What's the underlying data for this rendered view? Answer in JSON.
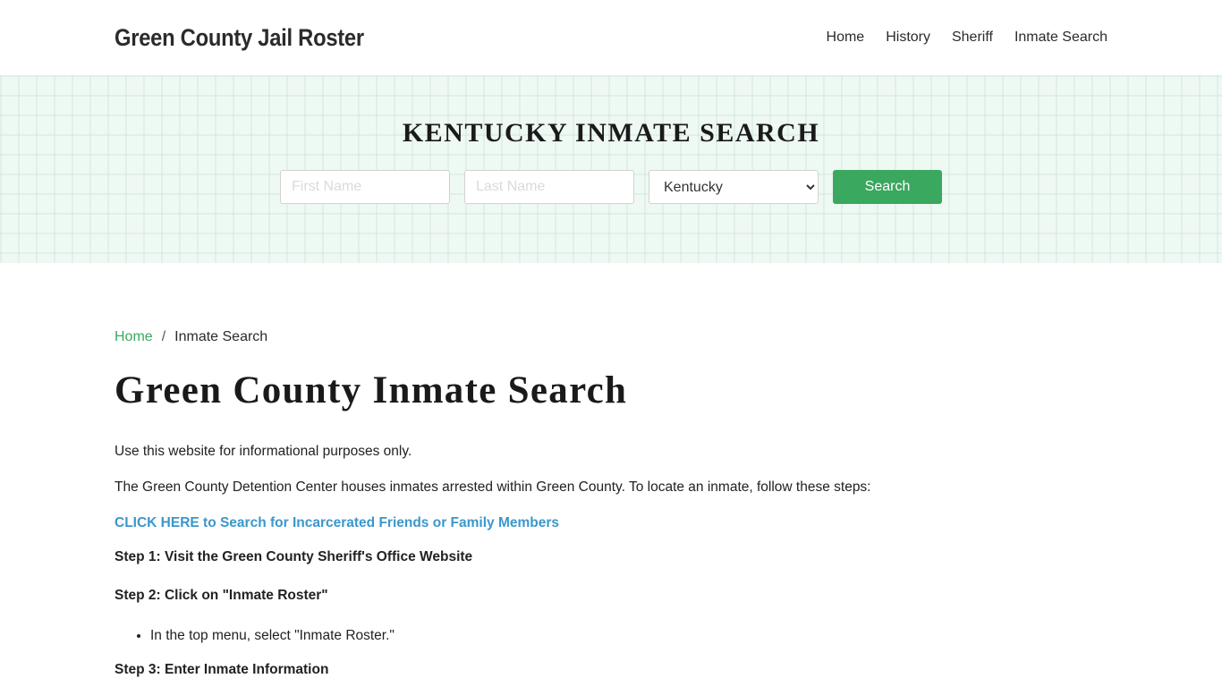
{
  "header": {
    "brand": "Green County Jail Roster",
    "nav": [
      {
        "label": "Home"
      },
      {
        "label": "History"
      },
      {
        "label": "Sheriff"
      },
      {
        "label": "Inmate Search"
      }
    ]
  },
  "hero": {
    "title": "KENTUCKY INMATE SEARCH",
    "first_name": {
      "placeholder": "First Name",
      "value": ""
    },
    "last_name": {
      "placeholder": "Last Name",
      "value": ""
    },
    "state_select": {
      "selected": "Kentucky"
    },
    "search_label": "Search"
  },
  "breadcrumb": {
    "home": "Home",
    "separator": "/",
    "current": "Inmate Search"
  },
  "main": {
    "title": "Green County Inmate Search",
    "intro": "Use this website for informational purposes only.",
    "description": "The Green County Detention Center houses inmates arrested within Green County. To locate an inmate, follow these steps:",
    "cta_link": "CLICK HERE to Search for Incarcerated Friends or Family Members",
    "steps": [
      {
        "label": "Step 1: Visit the Green County Sheriff's Office Website"
      },
      {
        "label": "Step 2: Click on \"Inmate Roster\"",
        "bullets": [
          "In the top menu, select \"Inmate Roster.\""
        ]
      },
      {
        "label": "Step 3: Enter Inmate Information"
      }
    ]
  },
  "colors": {
    "accent_green": "#3aa85e",
    "link_blue": "#3a97cc",
    "hero_bg": "#eef9f3"
  }
}
